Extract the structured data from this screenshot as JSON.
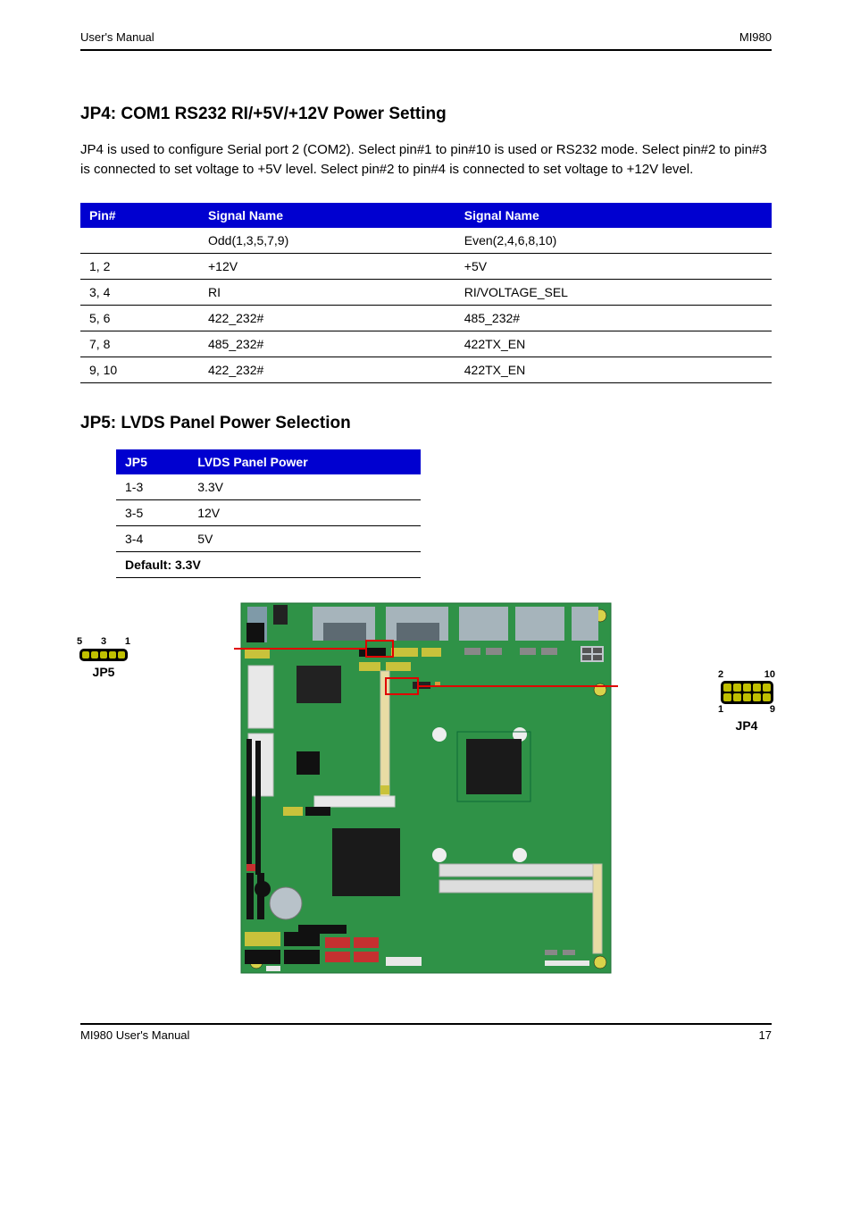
{
  "header": {
    "left": "User's Manual",
    "right": "MI980"
  },
  "section1": {
    "title": "JP4: COM1 RS232 RI/+5V/+12V Power Setting",
    "desc": "JP4 is used to configure Serial port 2 (COM2). Select pin#1 to pin#10 is used or RS232 mode. Select pin#2 to pin#3 is connected to set voltage to +5V level. Select pin#2 to pin#4 is connected to set voltage to +12V level.",
    "table": {
      "headers": [
        "Pin#",
        "Signal Name",
        "Signal Name"
      ],
      "subheaders": [
        "",
        "Odd(1,3,5,7,9)",
        "Even(2,4,6,8,10)"
      ],
      "rows": [
        [
          "1, 2",
          "+12V",
          "+5V"
        ],
        [
          "3, 4",
          "RI",
          "RI/VOLTAGE_SEL"
        ],
        [
          "5, 6",
          "422_232#",
          "485_232#"
        ],
        [
          "7, 8",
          "485_232#",
          "422TX_EN"
        ],
        [
          "9, 10",
          "422_232#",
          "422TX_EN"
        ]
      ]
    }
  },
  "section2": {
    "title": "JP5: LVDS Panel Power Selection",
    "table": {
      "headers": [
        "JP5",
        "LVDS Panel Power"
      ],
      "rows": [
        [
          "1-3",
          "3.3V"
        ],
        [
          "3-5",
          "12V"
        ],
        [
          "3-4",
          "5V"
        ]
      ]
    },
    "note": "Default: 3.3V"
  },
  "callouts": {
    "left": {
      "label": "JP5",
      "pins_top": "5  3  1",
      "pins_bottom": ""
    },
    "right": {
      "label": "JP4",
      "pins_top": "2        10",
      "pins_bottom": "1          9"
    }
  },
  "footer": {
    "left": "MI980 User's Manual",
    "right": "17"
  }
}
